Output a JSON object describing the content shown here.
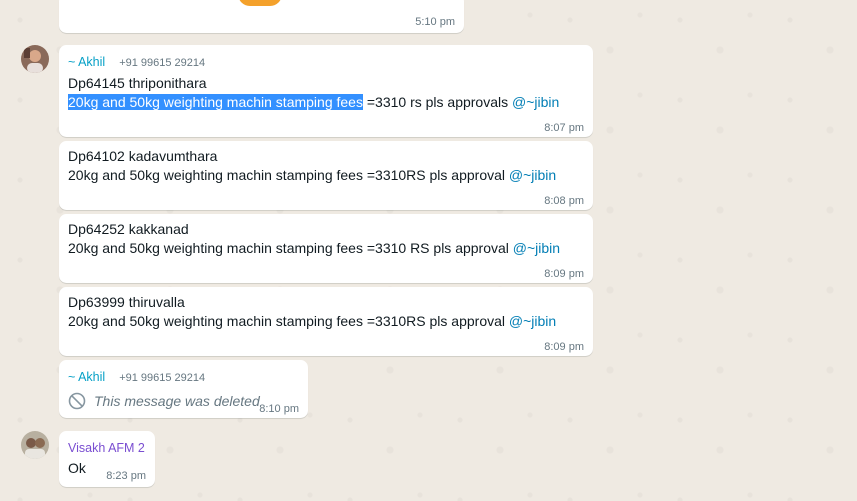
{
  "messages": [
    {
      "id": "prev",
      "time": "5:10 pm"
    },
    {
      "id": "m1",
      "sender": "~ Akhil",
      "phone": "+91 99615 29214",
      "line1": "Dp64145 thriponithara",
      "line2_selected": "20kg and 50kg weighting machin stamping fees",
      "line2_rest": " =3310 rs pls approvals ",
      "mention": "@~jibin",
      "time": "8:07 pm"
    },
    {
      "id": "m2",
      "line1": "Dp64102 kadavumthara",
      "line2": "20kg and 50kg weighting machin stamping fees =3310RS pls approval ",
      "mention": "@~jibin",
      "time": "8:08 pm"
    },
    {
      "id": "m3",
      "line1": "Dp64252 kakkanad",
      "line2": "20kg and 50kg weighting machin stamping fees =3310 RS pls approval ",
      "mention": "@~jibin",
      "time": "8:09 pm"
    },
    {
      "id": "m4",
      "line1": "Dp63999 thiruvalla",
      "line2": "20kg and 50kg weighting machin stamping fees =3310RS pls approval ",
      "mention": "@~jibin",
      "time": "8:09 pm"
    },
    {
      "id": "m5",
      "sender": "~ Akhil",
      "phone": "+91 99615 29214",
      "deleted_text": "This message was deleted",
      "time": "8:10 pm"
    },
    {
      "id": "m6",
      "sender": "Visakh AFM 2",
      "text": "Ok",
      "time": "8:23 pm"
    }
  ],
  "colors": {
    "akhil_name": "#06a0c7",
    "visakh_name": "#7a4ed1",
    "mention": "#027eb5",
    "selection": "#3390ff"
  }
}
